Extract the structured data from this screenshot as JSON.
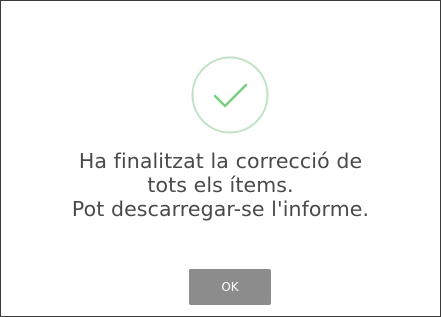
{
  "dialog": {
    "icon": "check-circle-icon",
    "message_lines": [
      "Ha finalitzat la correcció de",
      "tots els ítems.",
      "Pot descarregar-se l'informe."
    ],
    "ok_label": "OK"
  },
  "colors": {
    "success_green": "#7ccf83",
    "success_circle": "#bfe3c2",
    "button_bg": "#8c8c8c",
    "button_text": "#ffffff",
    "text": "#4a4a4a"
  }
}
